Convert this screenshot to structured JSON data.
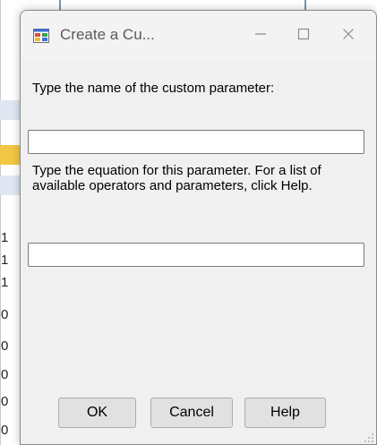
{
  "window": {
    "title": "Create a Cu..."
  },
  "name_prompt": {
    "label": "Type the name of the custom parameter:",
    "value": ""
  },
  "equation_prompt": {
    "label": "Type the equation for this parameter.  For a list of available operators and parameters, click Help.",
    "value": ""
  },
  "buttons": {
    "ok": "OK",
    "cancel": "Cancel",
    "help": "Help"
  },
  "background": {
    "row_digits": [
      "1",
      "1",
      "1",
      "0",
      "0",
      "0",
      "0",
      "0"
    ],
    "highlight_color": "#f2c744",
    "band_color": "#dfe7f2"
  },
  "colors": {
    "dialog_bg": "#f0f0f0",
    "titlebar_text": "#5a5a5a",
    "button_bg": "#e1e1e1"
  }
}
